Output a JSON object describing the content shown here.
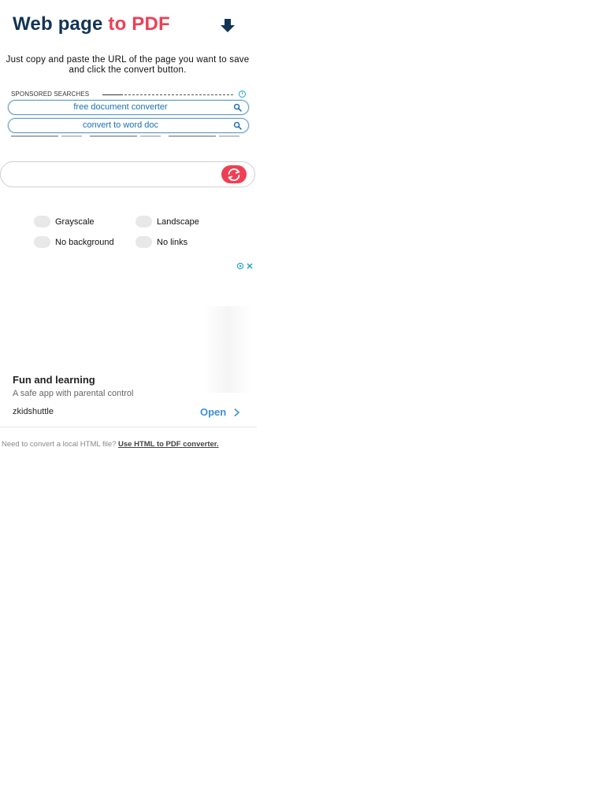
{
  "header": {
    "title_part1": "Web page",
    "title_part2": "to PDF",
    "arrow_icon": "arrow-down-icon"
  },
  "subtitle": "Just copy and paste the URL of the page you want to save and click the convert button.",
  "sponsored": {
    "label": "SPONSORED SEARCHES",
    "searches": [
      "free document converter",
      "convert to word doc"
    ]
  },
  "url_input": {
    "value": "",
    "placeholder": ""
  },
  "options": {
    "grayscale": "Grayscale",
    "landscape": "Landscape",
    "no_background": "No background",
    "no_links": "No links"
  },
  "ad": {
    "headline": "Fun and learning",
    "description": "A safe app with parental control",
    "advertiser": "zkidshuttle",
    "cta": "Open"
  },
  "footer": {
    "question": "Need to convert a local HTML file?",
    "link": "Use HTML to PDF converter."
  },
  "colors": {
    "brand_dark": "#123456",
    "brand_red": "#ee3f54",
    "link_blue": "#1d6fb1",
    "cta_blue": "#3d8fd6"
  }
}
